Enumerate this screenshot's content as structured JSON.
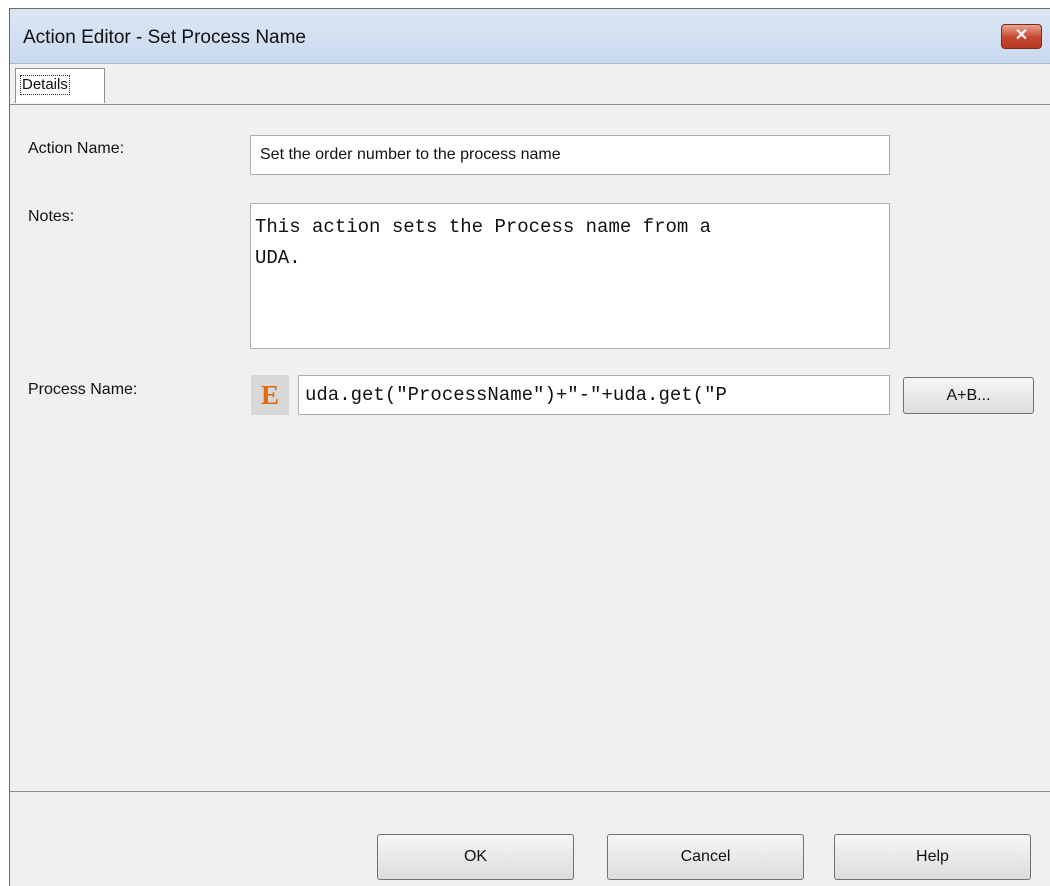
{
  "window": {
    "title": "Action Editor - Set Process Name",
    "close_label": "✕"
  },
  "tabs": [
    {
      "label": "Details",
      "selected": true
    }
  ],
  "form": {
    "action_name": {
      "label": "Action Name:",
      "value": "Set the order number to the process name"
    },
    "notes": {
      "label": "Notes:",
      "value": "This action sets the Process name from a\nUDA."
    },
    "process_name": {
      "label": "Process Name:",
      "icon_text": "E",
      "icon": "expression-icon",
      "value": "uda.get(\"ProcessName\")+\"-\"+uda.get(\"P",
      "builder_label": "A+B..."
    }
  },
  "buttons": {
    "ok": "OK",
    "cancel": "Cancel",
    "help": "Help"
  },
  "colors": {
    "title_bar": "#c9d9ee",
    "close_button": "#c7452f",
    "expression_icon": "#e06a10",
    "dialog_background": "#f0f0f0"
  }
}
